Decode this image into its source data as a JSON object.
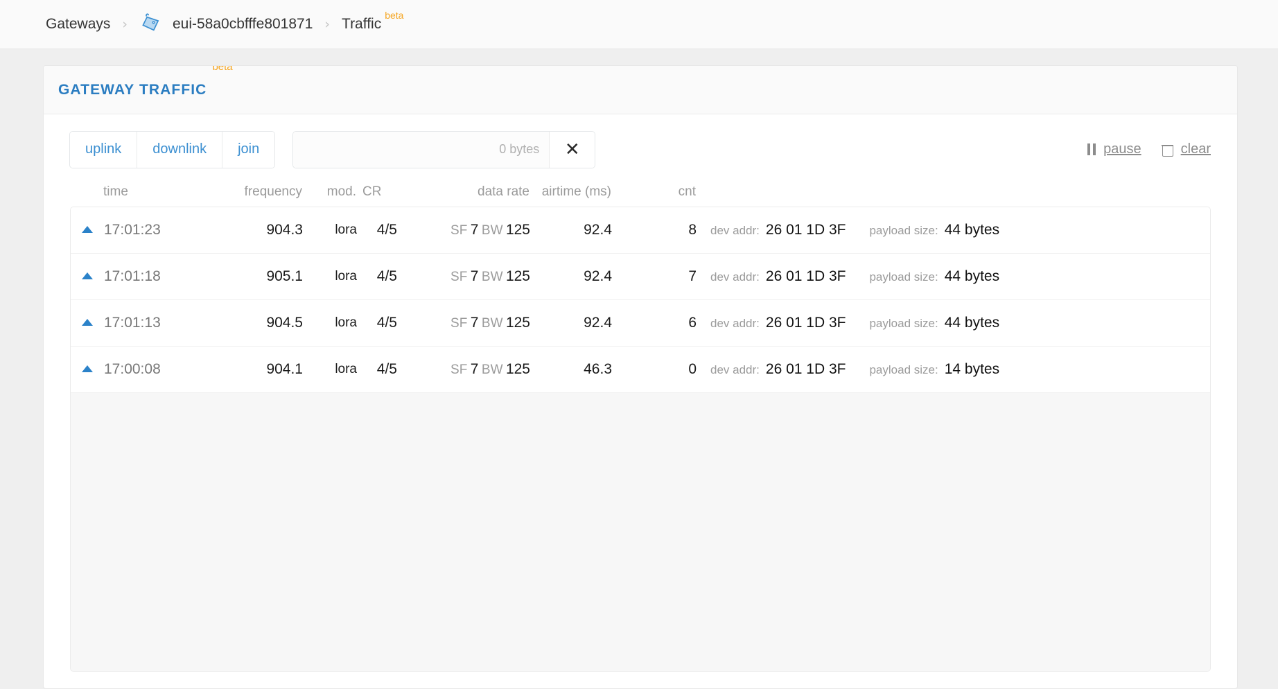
{
  "breadcrumb": {
    "items": [
      {
        "label": "Gateways",
        "icon": null
      },
      {
        "label": "eui-58a0cbfffe801871",
        "icon": "gateway-icon"
      },
      {
        "label": "Traffic",
        "icon": null
      }
    ],
    "separator": "›",
    "beta_tag": "beta"
  },
  "card": {
    "title": "GATEWAY TRAFFIC",
    "beta_tag": "beta",
    "accent_color": "#2b7dc1",
    "beta_color": "#f5a623"
  },
  "toolbar": {
    "filters": [
      {
        "label": "uplink",
        "name": "uplink"
      },
      {
        "label": "downlink",
        "name": "downlink"
      },
      {
        "label": "join",
        "name": "join"
      }
    ],
    "search": {
      "value": "",
      "placeholder": "",
      "byte_count": "0 bytes",
      "clear_icon": "✕"
    },
    "controls": [
      {
        "label": "pause",
        "icon": "pause-icon"
      },
      {
        "label": "clear",
        "icon": "trash-icon"
      }
    ]
  },
  "table": {
    "headers": {
      "time": "time",
      "frequency": "frequency",
      "mod": "mod.",
      "cr": "CR",
      "data_rate": "data rate",
      "airtime": "airtime (ms)",
      "cnt": "cnt"
    },
    "labels": {
      "sf": "SF",
      "bw": "BW",
      "dev_addr": "dev addr:",
      "payload_size": "payload size:"
    },
    "rows": [
      {
        "direction": "uplink",
        "time": "17:01:23",
        "frequency": "904.3",
        "mod": "lora",
        "cr": "4/5",
        "sf": "7",
        "bw": "125",
        "airtime": "92.4",
        "cnt": "8",
        "dev_addr": "26 01 1D 3F",
        "payload_size": "44 bytes"
      },
      {
        "direction": "uplink",
        "time": "17:01:18",
        "frequency": "905.1",
        "mod": "lora",
        "cr": "4/5",
        "sf": "7",
        "bw": "125",
        "airtime": "92.4",
        "cnt": "7",
        "dev_addr": "26 01 1D 3F",
        "payload_size": "44 bytes"
      },
      {
        "direction": "uplink",
        "time": "17:01:13",
        "frequency": "904.5",
        "mod": "lora",
        "cr": "4/5",
        "sf": "7",
        "bw": "125",
        "airtime": "92.4",
        "cnt": "6",
        "dev_addr": "26 01 1D 3F",
        "payload_size": "44 bytes"
      },
      {
        "direction": "uplink",
        "time": "17:00:08",
        "frequency": "904.1",
        "mod": "lora",
        "cr": "4/5",
        "sf": "7",
        "bw": "125",
        "airtime": "46.3",
        "cnt": "0",
        "dev_addr": "26 01 1D 3F",
        "payload_size": "14 bytes"
      }
    ]
  }
}
